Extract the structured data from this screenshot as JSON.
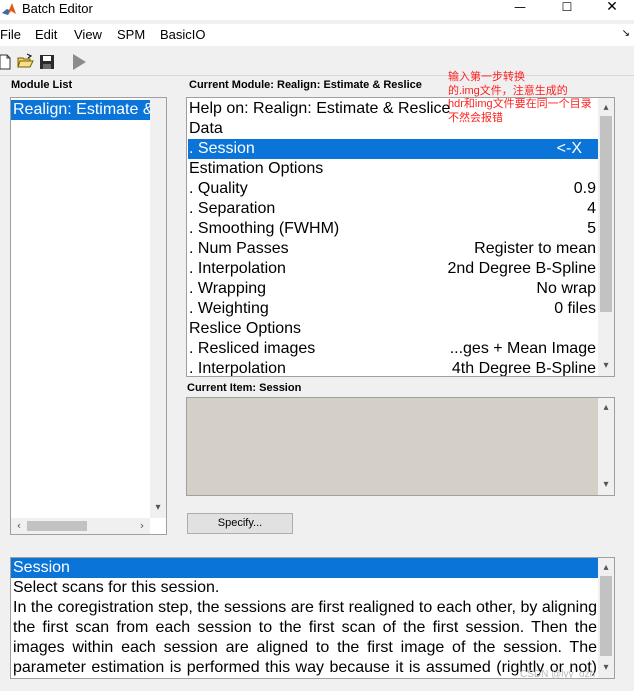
{
  "window": {
    "title": "Batch Editor",
    "minimize_glyph": "—",
    "maximize_glyph": "☐",
    "close_glyph": "✕"
  },
  "menu": {
    "items": [
      "File",
      "Edit",
      "View",
      "SPM",
      "BasicIO"
    ],
    "dock_glyph": "↘"
  },
  "module_list": {
    "heading": "Module List",
    "items": [
      "Realign: Estimate & Reslice"
    ]
  },
  "current_module": {
    "heading": "Current Module: Realign: Estimate & Reslice",
    "rows": [
      {
        "label": "Help on: Realign: Estimate & Reslice",
        "value": ""
      },
      {
        "label": "Data",
        "value": ""
      },
      {
        "label": ". Session",
        "value": "<-X"
      },
      {
        "label": "Estimation Options",
        "value": ""
      },
      {
        "label": ". Quality",
        "value": "0.9"
      },
      {
        "label": ". Separation",
        "value": "4"
      },
      {
        "label": ". Smoothing (FWHM)",
        "value": "5"
      },
      {
        "label": ". Num Passes",
        "value": "Register to mean"
      },
      {
        "label": ". Interpolation",
        "value": "2nd Degree B-Spline"
      },
      {
        "label": ". Wrapping",
        "value": "No wrap"
      },
      {
        "label": ". Weighting",
        "value": "0 files"
      },
      {
        "label": "Reslice Options",
        "value": ""
      },
      {
        "label": ". Resliced images",
        "value": "...ges + Mean Image"
      },
      {
        "label": ". Interpolation",
        "value": "4th Degree B-Spline"
      }
    ]
  },
  "annotation": {
    "lines": [
      "输入第一步转换",
      "的.img文件，注意生成的",
      "hdr和img文件要在同一个目录",
      "不然会报错"
    ],
    "color": "#ff2020"
  },
  "current_item": {
    "heading": "Current Item: Session",
    "content": ""
  },
  "specify_button": "Specify...",
  "help": {
    "title": "Session",
    "lead": "Select scans for this session.",
    "body": "In the coregistration step, the sessions are first realigned to each other, by aligning the first scan from each session to the first scan of the first session. Then the images within each session are aligned to the first image of the session. The parameter estimation is performed this way because it is assumed (rightly or not) that"
  },
  "watermark": "CSDN @lyy_ozh",
  "colors": {
    "selection": "#0a74d9",
    "panel_bg": "#ffffff",
    "window_bg": "#f0f0f0",
    "current_item_bg": "#d4d0c8"
  }
}
